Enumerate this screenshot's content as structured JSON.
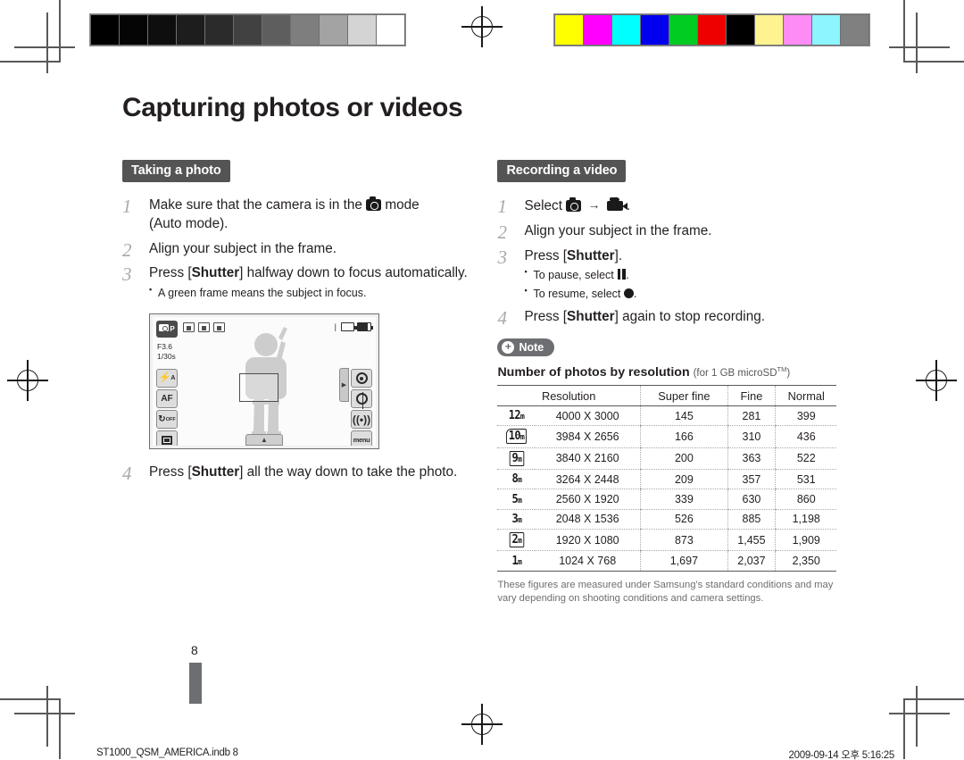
{
  "title": "Capturing photos or videos",
  "left": {
    "section_heading": "Taking a photo",
    "steps": [
      {
        "num": "1",
        "text_a": "Make sure that the camera is in the ",
        "icon": "camera-icon",
        "text_b": " mode (Auto mode)."
      },
      {
        "num": "2",
        "text_a": "Align your subject in the frame.",
        "icon": "",
        "text_b": ""
      },
      {
        "num": "3",
        "text_a": "Press [Shutter] halfway down to focus automatically.",
        "icon": "",
        "text_b": "",
        "sub": "A green frame means the subject in focus."
      },
      {
        "num": "4",
        "text_a": "Press [Shutter] all the way down to take the photo.",
        "icon": "",
        "text_b": ""
      }
    ],
    "step_labels": {
      "s1_pre": "Make sure that the camera is in the",
      "s1_post": "mode",
      "s1_line2": "(Auto mode).",
      "s2": "Align your subject in the frame.",
      "s3_pre": "Press [",
      "s3_bold": "Shutter",
      "s3_post": "] halfway down to focus automatically.",
      "s3_sub": "A green frame means the subject in focus.",
      "s4_pre": "Press [",
      "s4_bold": "Shutter",
      "s4_post": "] all the way down to take the photo."
    }
  },
  "lcd": {
    "mode_label": "P",
    "aperture": "F3.6",
    "shutter_speed": "1/30s",
    "left_buttons": [
      {
        "name": "flash-auto-button",
        "label": "A"
      },
      {
        "name": "af-button",
        "label": "AF"
      },
      {
        "name": "timer-off-button",
        "label": "OFF"
      },
      {
        "name": "display-button",
        "label": ""
      }
    ],
    "right_buttons": [
      {
        "name": "smart-filter-button",
        "label": ""
      },
      {
        "name": "focus-area-button",
        "label": ""
      },
      {
        "name": "wireless-button",
        "label": ""
      },
      {
        "name": "menu-button",
        "label": "menu"
      }
    ]
  },
  "right": {
    "section_heading": "Recording a video",
    "steps": {
      "s1_pre": "Select",
      "s1_arrow": "→",
      "s1_post": ".",
      "s2": "Align your subject in the frame.",
      "s3_pre": "Press [",
      "s3_bold": "Shutter",
      "s3_post": "].",
      "s3_sub1_pre": "To pause, select",
      "s3_sub1_post": ".",
      "s3_sub2_pre": "To resume, select",
      "s3_sub2_post": ".",
      "s4_pre": "Press [",
      "s4_bold": "Shutter",
      "s4_post": "] again to stop recording."
    },
    "note_label": "Note",
    "note_plus": "+",
    "table_title": "Number of photos by resolution",
    "table_subtitle": "(for 1 GB microSD",
    "table_subtitle_tm": "TM",
    "table_subtitle_end": ")",
    "footnote": "These figures are measured under Samsung's standard conditions and may vary depending on shooting conditions and camera settings."
  },
  "chart_data": {
    "type": "table",
    "title": "Number of photos by resolution (for 1 GB microSD™)",
    "columns": [
      "Resolution",
      "Super fine",
      "Fine",
      "Normal"
    ],
    "rows": [
      {
        "icon": "12m",
        "icon_style": "plain",
        "resolution": "4000 X 3000",
        "super_fine": "145",
        "fine": "281",
        "normal": "399"
      },
      {
        "icon": "10m",
        "icon_style": "rounded",
        "resolution": "3984 X 2656",
        "super_fine": "166",
        "fine": "310",
        "normal": "436"
      },
      {
        "icon": "9m",
        "icon_style": "boxed",
        "resolution": "3840 X 2160",
        "super_fine": "200",
        "fine": "363",
        "normal": "522"
      },
      {
        "icon": "8m",
        "icon_style": "plain",
        "resolution": "3264 X 2448",
        "super_fine": "209",
        "fine": "357",
        "normal": "531"
      },
      {
        "icon": "5m",
        "icon_style": "plain",
        "resolution": "2560 X 1920",
        "super_fine": "339",
        "fine": "630",
        "normal": "860"
      },
      {
        "icon": "3m",
        "icon_style": "plain",
        "resolution": "2048 X 1536",
        "super_fine": "526",
        "fine": "885",
        "normal": "1,198"
      },
      {
        "icon": "2m",
        "icon_style": "boxed",
        "resolution": "1920 X 1080",
        "super_fine": "873",
        "fine": "1,455",
        "normal": "1,909"
      },
      {
        "icon": "1m",
        "icon_style": "plain",
        "resolution": "1024 X 768",
        "super_fine": "1,697",
        "fine": "2,037",
        "normal": "2,350"
      }
    ]
  },
  "page_number": "8",
  "footer": {
    "left": "ST1000_QSM_AMERICA.indb   8",
    "right": "2009-09-14   오후 5:16:25"
  },
  "calibration": {
    "gray_swatches": [
      "#000000",
      "#050505",
      "#0e0e0e",
      "#1d1d1d",
      "#2b2b2b",
      "#414141",
      "#5e5e5e",
      "#7e7e7e",
      "#a3a3a3",
      "#d4d4d4",
      "#ffffff"
    ],
    "color_swatches": [
      "#ffff00",
      "#ff00ff",
      "#00ffff",
      "#0000ee",
      "#00cc22",
      "#ee0000",
      "#000000",
      "#fff391",
      "#ff8cf5",
      "#8cf5ff",
      "#808080"
    ]
  }
}
